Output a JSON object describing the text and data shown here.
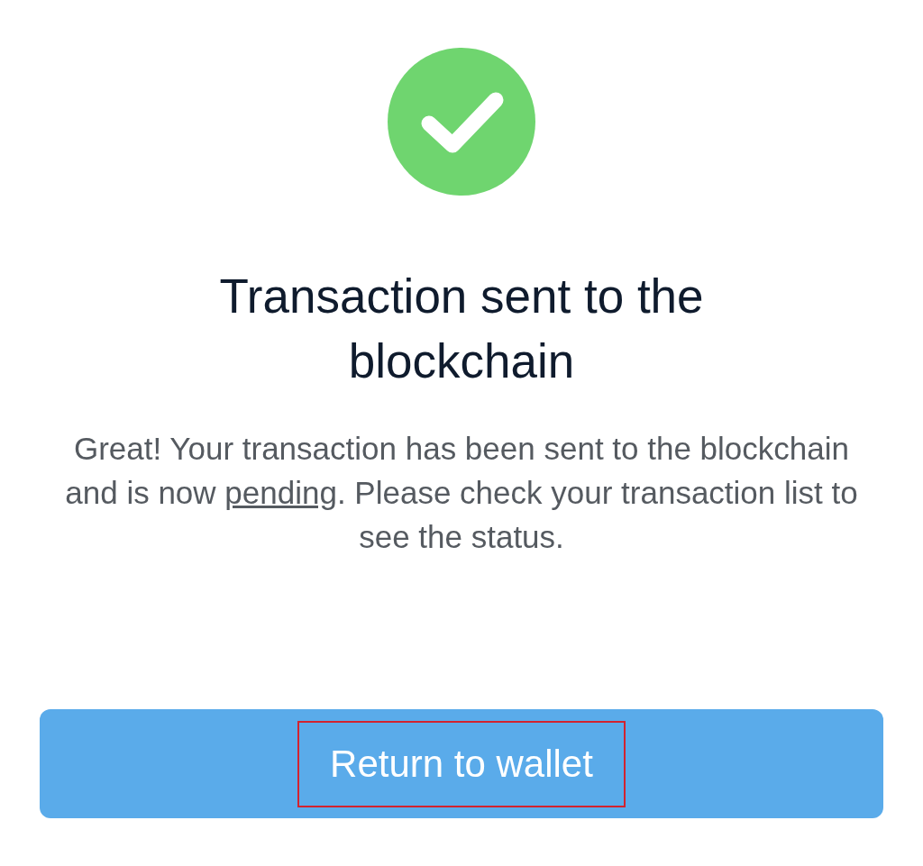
{
  "status_icon": {
    "kind": "success"
  },
  "title": "Transaction sent to the blockchain",
  "message": {
    "before": "Great! Your transaction has been sent to the blockchain and is now ",
    "link": "pending",
    "after": ". Please check your transaction list to see the status."
  },
  "button": {
    "label": "Return to wallet",
    "highlighted": true
  }
}
